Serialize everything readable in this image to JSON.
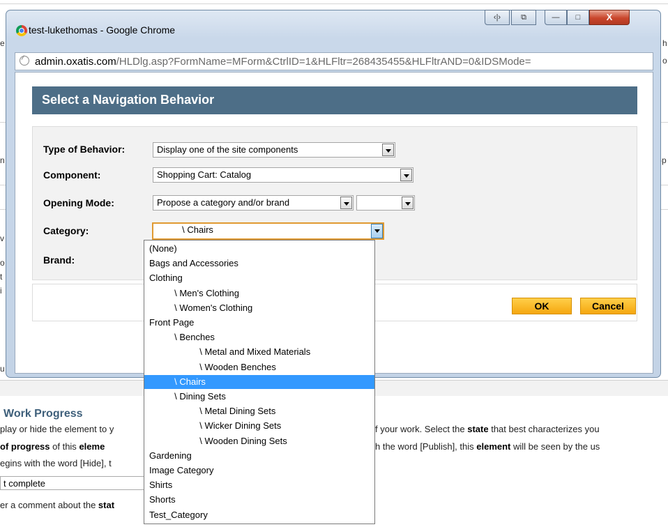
{
  "background": {
    "fragments_left": [
      "e",
      "n",
      "n",
      "v",
      "o",
      "t",
      "i",
      "u"
    ],
    "fragments_right": [
      "h",
      "o",
      "-p"
    ],
    "work_progress": {
      "title": "Work Progress",
      "line1_a": "play or hide the element to y",
      "line1_b": "f your work. Select the ",
      "line1_bold": "state",
      "line1_c": " that best characterizes you",
      "line2_bold_a": "of progress",
      "line2_a": " of this ",
      "line2_bold_b": "eleme",
      "line2_b": "h the word [Publish], this ",
      "line2_bold_c": "element",
      "line2_c": " will be seen by the us",
      "line3_a": "egins with the word [Hide], t",
      "state_value": "t complete",
      "line4_a": "er a comment about the ",
      "line4_bold": "stat"
    }
  },
  "window": {
    "title": "test-lukethomas - Google Chrome",
    "buttons": {
      "code": "‹|›",
      "copy": "⧉",
      "minimize": "—",
      "maximize": "□",
      "close": "X"
    },
    "address_host": "admin.oxatis.com",
    "address_path": "/HLDlg.asp?FormName=MForm&CtrlID=1&HLFltr=268435455&HLFltrAND=0&IDSMode="
  },
  "dialog": {
    "title": "Select a Navigation Behavior",
    "fields": {
      "type_label": "Type of Behavior:",
      "type_value": "Display one of the site components",
      "component_label": "Component:",
      "component_value": "Shopping Cart: Catalog",
      "opening_label": "Opening Mode:",
      "opening_value": "Propose a category and/or brand",
      "opening_extra_value": "",
      "category_label": "Category:",
      "category_value": "          \\ Chairs",
      "brand_label": "Brand:"
    },
    "ok_label": "OK",
    "cancel_label": "Cancel"
  },
  "category_options": [
    "(None)",
    "Bags and Accessories",
    "Clothing",
    "          \\ Men's Clothing",
    "          \\ Women's Clothing",
    "Front Page",
    "          \\ Benches",
    "                    \\ Metal and Mixed Materials",
    "                    \\ Wooden Benches",
    "          \\ Chairs",
    "          \\ Dining Sets",
    "                    \\ Metal Dining Sets",
    "                    \\ Wicker Dining Sets",
    "                    \\ Wooden Dining Sets",
    "Gardening",
    "Image Category",
    "Shirts",
    "Shorts",
    "Test_Category"
  ],
  "selected_option": "          \\ Chairs",
  "colors": {
    "dialog_header": "#4d6e87",
    "button_orange": "#f5a70f",
    "selection_blue": "#3399ff",
    "focus_border": "#e09a32"
  }
}
